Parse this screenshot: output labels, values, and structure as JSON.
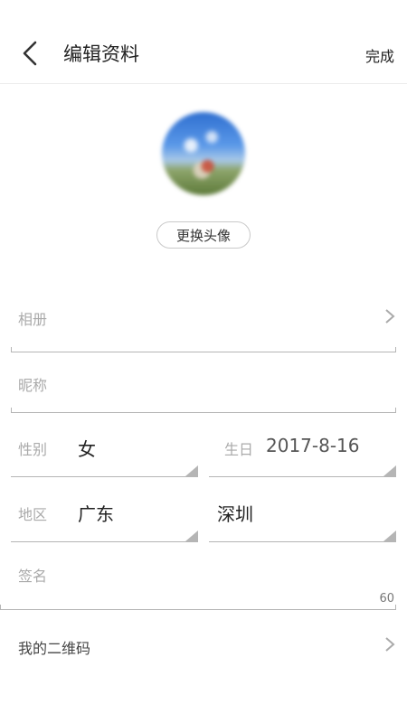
{
  "header": {
    "title": "编辑资料",
    "done_label": "完成"
  },
  "avatar": {
    "change_label": "更换头像"
  },
  "form": {
    "album_label": "相册",
    "nickname_label": "昵称",
    "gender_label": "性别",
    "gender_value": "女",
    "birthday_label": "生日",
    "birthday_value": "2017-8-16",
    "region_label": "地区",
    "province_value": "广东",
    "city_value": "深圳",
    "signature_label": "签名",
    "signature_counter": "60",
    "qrcode_label": "我的二维码"
  },
  "icons": {
    "back": "back-arrow-icon",
    "chevron": "chevron-right-icon",
    "dropdown": "dropdown-triangle-icon"
  }
}
